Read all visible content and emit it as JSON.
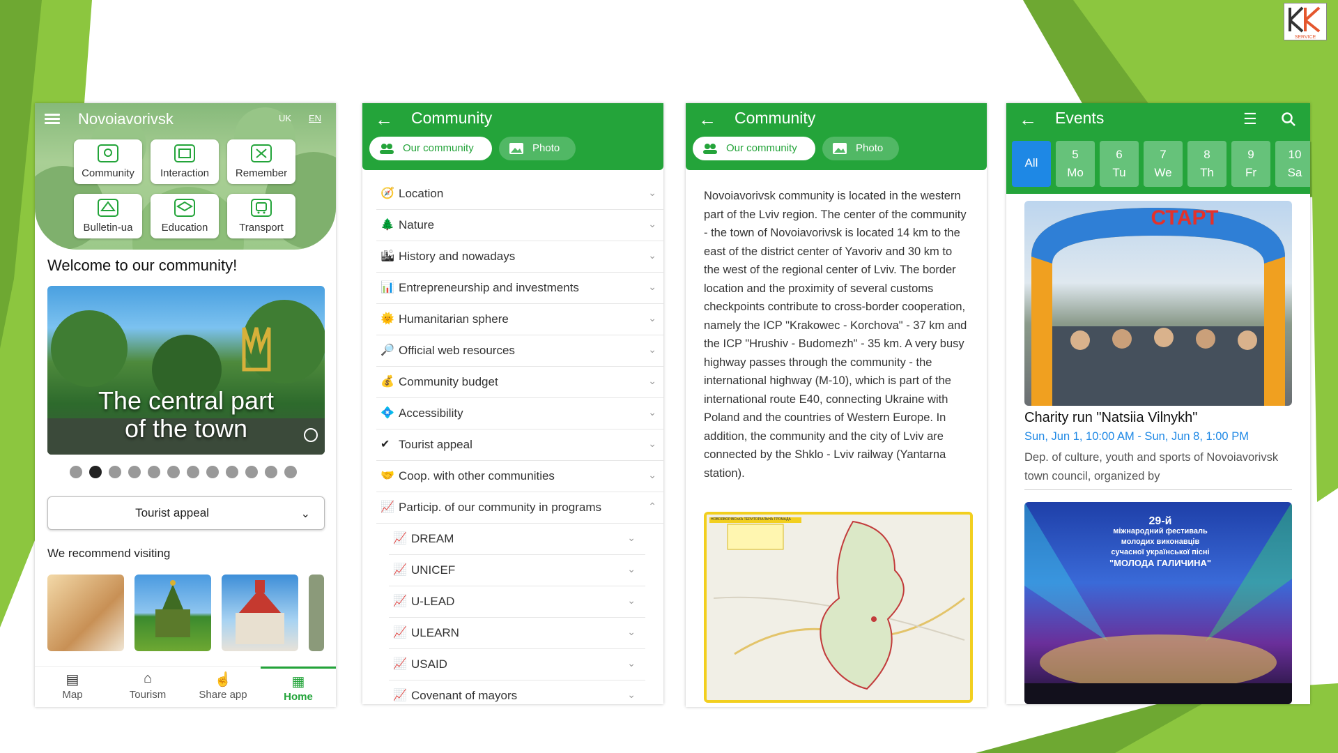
{
  "colors": {
    "primary_green": "#24a43a",
    "accent_blue": "#1e88e5",
    "map_border": "#f2cf1f"
  },
  "logo": {
    "text": "KK",
    "sub": "SERVICE"
  },
  "phone1": {
    "title": "Novoiavorivsk",
    "lang_uk": "UK",
    "lang_en": "EN",
    "tiles": [
      {
        "label": "Community",
        "icon": "community-icon"
      },
      {
        "label": "Interaction",
        "icon": "interaction-icon"
      },
      {
        "label": "Remember",
        "icon": "remember-icon"
      },
      {
        "label": "Bulletin-ua",
        "icon": "bulletin-icon"
      },
      {
        "label": "Education",
        "icon": "education-icon"
      },
      {
        "label": "Transport",
        "icon": "transport-icon"
      }
    ],
    "welcome": "Welcome to our community!",
    "hero_text_line1": "The central part",
    "hero_text_line2": "of the town",
    "carousel_count": 12,
    "carousel_active_index": 1,
    "dropdown_value": "Tourist appeal",
    "recommend_title": "We recommend visiting",
    "nav": [
      {
        "label": "Map",
        "icon": "map-icon"
      },
      {
        "label": "Tourism",
        "icon": "tourism-icon"
      },
      {
        "label": "Share app",
        "icon": "thumbs-up-icon"
      },
      {
        "label": "Home",
        "icon": "home-grid-icon",
        "active": true
      }
    ]
  },
  "phone2": {
    "title": "Community",
    "chip_active": "Our community",
    "chip_inactive": "Photo",
    "items": [
      {
        "emoji": "🧭",
        "label": "Location"
      },
      {
        "emoji": "🌲",
        "label": "Nature"
      },
      {
        "emoji": "🏙",
        "label": "History and nowadays"
      },
      {
        "emoji": "📊",
        "label": "Entrepreneurship and investments"
      },
      {
        "emoji": "🌞",
        "label": "Humanitarian sphere"
      },
      {
        "emoji": "🔎",
        "label": "Official web resources"
      },
      {
        "emoji": "💰",
        "label": "Community budget"
      },
      {
        "emoji": "💠",
        "label": "Accessibility"
      },
      {
        "emoji": "✔",
        "label": "Tourist appeal"
      },
      {
        "emoji": "🤝",
        "label": "Coop. with other communities"
      },
      {
        "emoji": "📈",
        "label": "Particip. of our community in programs",
        "expanded": true
      }
    ],
    "subitems": [
      {
        "emoji": "📈",
        "label": "DREAM"
      },
      {
        "emoji": "📈",
        "label": "UNICEF"
      },
      {
        "emoji": "📈",
        "label": "U-LEAD"
      },
      {
        "emoji": "📈",
        "label": "ULEARN"
      },
      {
        "emoji": "📈",
        "label": "USAID"
      },
      {
        "emoji": "📈",
        "label": "Covenant of mayors"
      }
    ]
  },
  "phone3": {
    "title": "Community",
    "chip_active": "Our community",
    "chip_inactive": "Photo",
    "description": "Novoiavorivsk community is located in the western part of the Lviv region. The center of the community - the town of Novoiavorivsk is located 14 km to the east of the district center of Yavoriv and 30 km to the west of the regional center of Lviv. The border location and the proximity of several customs checkpoints contribute to cross-border cooperation, namely the ICP \"Krakowec - Korchova\" - 37 km and the ICP \"Hrushiv - Budomezh\" - 35 km. A very busy highway passes through the community - the international highway (M-10), which is part of the international route E40, connecting Ukraine with Poland and the countries of Western Europe. In addition, the community and the city of Lviv are connected by the Shklo - Lviv railway (Yantarna station).",
    "map_label": "НОВОЯВОРІВСЬКА ТЕРИТОРІАЛЬНА ГРОМАДА"
  },
  "phone4": {
    "title": "Events",
    "days": [
      {
        "num": "All",
        "wd": ""
      },
      {
        "num": "5",
        "wd": "Mo"
      },
      {
        "num": "6",
        "wd": "Tu"
      },
      {
        "num": "7",
        "wd": "We"
      },
      {
        "num": "8",
        "wd": "Th"
      },
      {
        "num": "9",
        "wd": "Fr"
      },
      {
        "num": "10",
        "wd": "Sa"
      }
    ],
    "banner_text": "СТАРТ",
    "event_title": "Charity run \"Natsiia Vilnykh\"",
    "event_dates": "Sun, Jun 1, 10:00 AM - Sun, Jun 8, 1:00 PM",
    "event_org": "Dep. of culture, youth and sports of Novoiavorivsk town council, organized by",
    "poster_line1": "29-й",
    "poster_line2": "міжнародний фестиваль",
    "poster_line3": "молодих виконавців",
    "poster_line4": "сучасної української пісні",
    "poster_line5": "\"МОЛОДА ГАЛИЧИНА\""
  }
}
